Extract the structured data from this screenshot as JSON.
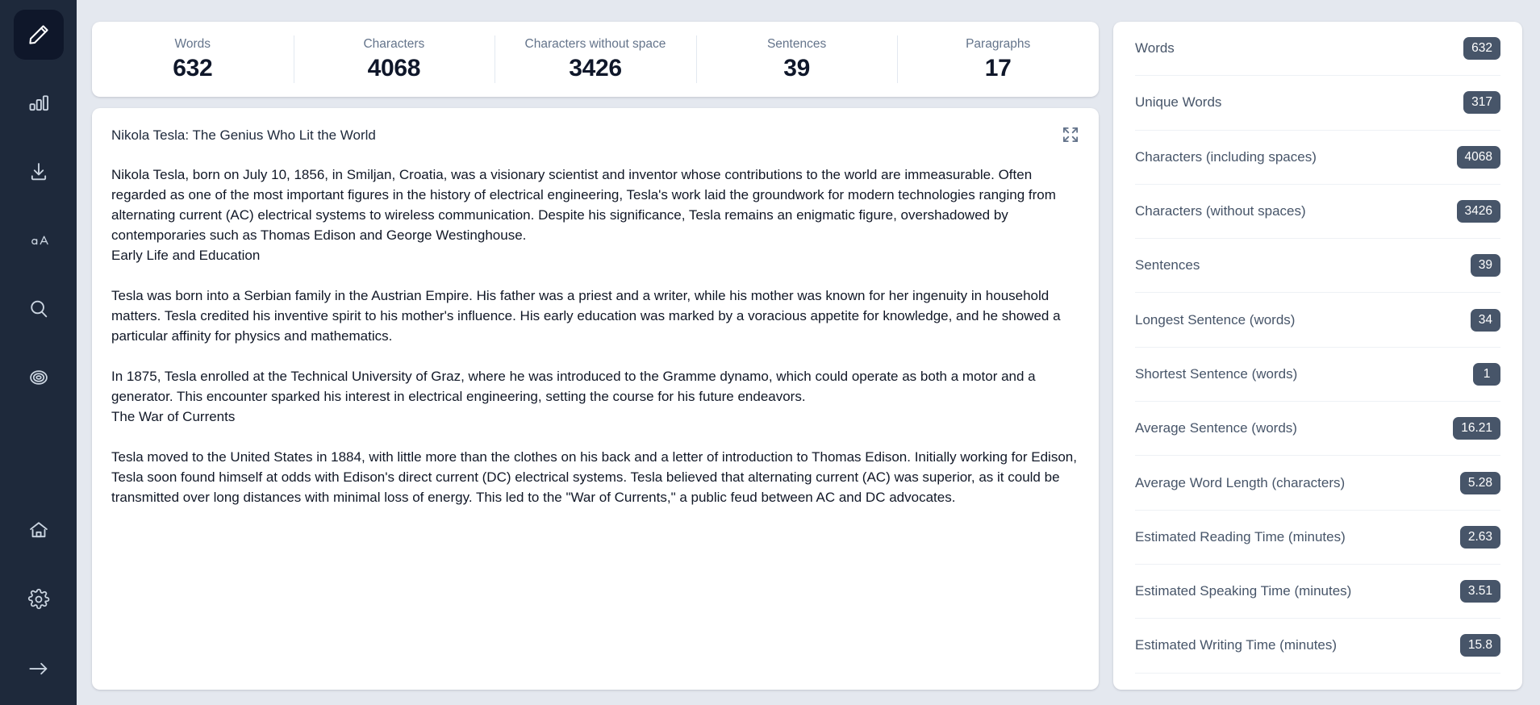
{
  "sidebar": {
    "items": [
      {
        "name": "editor",
        "icon": "pencil-icon",
        "active": true
      },
      {
        "name": "analytics",
        "icon": "bar-chart-icon",
        "active": false
      },
      {
        "name": "download",
        "icon": "download-icon",
        "active": false
      },
      {
        "name": "text-case",
        "icon": "text-case-icon",
        "active": false
      },
      {
        "name": "search",
        "icon": "search-icon",
        "active": false
      },
      {
        "name": "target",
        "icon": "target-icon",
        "active": false
      }
    ],
    "bottom_items": [
      {
        "name": "home",
        "icon": "home-icon"
      },
      {
        "name": "settings",
        "icon": "gear-icon"
      },
      {
        "name": "collapse",
        "icon": "arrow-right-icon"
      }
    ]
  },
  "stats_strip": [
    {
      "label": "Words",
      "value": "632"
    },
    {
      "label": "Characters",
      "value": "4068"
    },
    {
      "label": "Characters without space",
      "value": "3426"
    },
    {
      "label": "Sentences",
      "value": "39"
    },
    {
      "label": "Paragraphs",
      "value": "17"
    }
  ],
  "document": {
    "title": "Nikola Tesla: The Genius Who Lit the World",
    "expand_icon": "expand-icon",
    "paragraphs": [
      "Nikola Tesla, born on July 10, 1856, in Smiljan, Croatia, was a visionary scientist and inventor whose contributions to the world are immeasurable. Often regarded as one of the most important figures in the history of electrical engineering, Tesla's work laid the groundwork for modern technologies ranging from alternating current (AC) electrical systems to wireless communication. Despite his significance, Tesla remains an enigmatic figure, overshadowed by contemporaries such as Thomas Edison and George Westinghouse.\nEarly Life and Education",
      "Tesla was born into a Serbian family in the Austrian Empire. His father was a priest and a writer, while his mother was known for her ingenuity in household matters. Tesla credited his inventive spirit to his mother's influence. His early education was marked by a voracious appetite for knowledge, and he showed a particular affinity for physics and mathematics.",
      "In 1875, Tesla enrolled at the Technical University of Graz, where he was introduced to the Gramme dynamo, which could operate as both a motor and a generator. This encounter sparked his interest in electrical engineering, setting the course for his future endeavors.\nThe War of Currents",
      "Tesla moved to the United States in 1884, with little more than the clothes on his back and a letter of introduction to Thomas Edison. Initially working for Edison, Tesla soon found himself at odds with Edison's direct current (DC) electrical systems. Tesla believed that alternating current (AC) was superior, as it could be transmitted over long distances with minimal loss of energy. This led to the \"War of Currents,\" a public feud between AC and DC advocates."
    ]
  },
  "metrics": [
    {
      "label": "Words",
      "value": "632"
    },
    {
      "label": "Unique Words",
      "value": "317"
    },
    {
      "label": "Characters (including spaces)",
      "value": "4068"
    },
    {
      "label": "Characters (without spaces)",
      "value": "3426"
    },
    {
      "label": "Sentences",
      "value": "39"
    },
    {
      "label": "Longest Sentence (words)",
      "value": "34"
    },
    {
      "label": "Shortest Sentence (words)",
      "value": "1"
    },
    {
      "label": "Average Sentence (words)",
      "value": "16.21"
    },
    {
      "label": "Average Word Length (characters)",
      "value": "5.28"
    },
    {
      "label": "Estimated Reading Time (minutes)",
      "value": "2.63"
    },
    {
      "label": "Estimated Speaking Time (minutes)",
      "value": "3.51"
    },
    {
      "label": "Estimated Writing Time (minutes)",
      "value": "15.8"
    }
  ],
  "colors": {
    "sidebar_bg": "#1e293b",
    "sidebar_active_bg": "#0f172a",
    "page_bg": "#e4e8ef",
    "card_bg": "#ffffff",
    "badge_bg": "#475569",
    "stat_value": "#0f172a",
    "stat_label": "#64748b"
  }
}
